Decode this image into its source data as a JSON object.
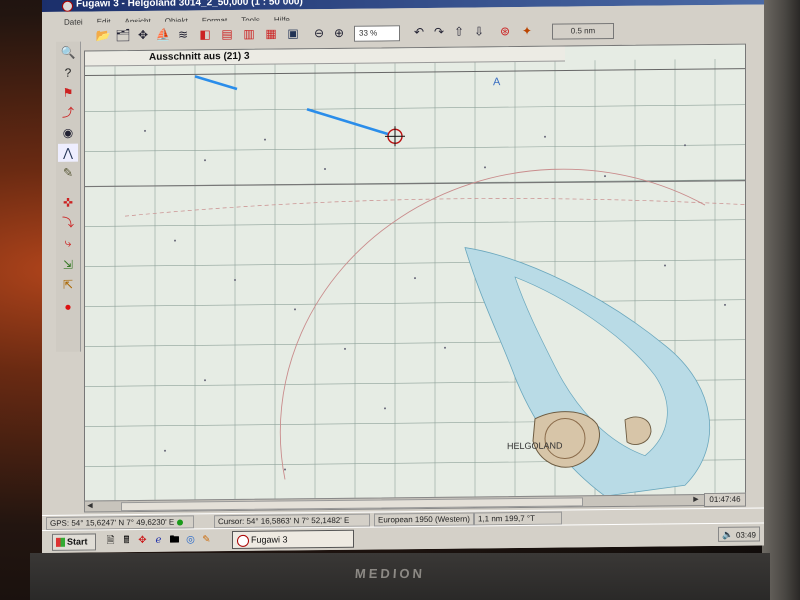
{
  "window": {
    "title": "Fugawi 3 - Helgoland 3014_2_50,000  (1 : 50 000)"
  },
  "menu": {
    "items": [
      "Datei",
      "Edit",
      "Ansicht",
      "Objekt",
      "Format",
      "Tools",
      "Hilfe"
    ]
  },
  "toolbar": {
    "zoom_value": "33 %",
    "scale_label": "0.5 nm",
    "icons": [
      "open-icon",
      "save-icon",
      "move-icon",
      "route-icon",
      "layers-icon",
      "waypoint-left-icon",
      "waypoint-list-icon",
      "route-list-icon",
      "track-icon",
      "chart-icon",
      "zoom-out-icon",
      "zoom-in-icon",
      "back-icon",
      "forward-icon",
      "up-icon",
      "down-icon",
      "gps-icon",
      "info-icon"
    ]
  },
  "left_tools": {
    "icons": [
      "zoom-tool-icon",
      "help-tool-icon",
      "waypoint-tool-icon",
      "route-tool-icon",
      "camera-icon",
      "select-icon",
      "pencil-icon",
      "crosshair-tool-icon",
      "route-edit-icon",
      "track-edit-icon",
      "chart-calibrate-icon",
      "measure-icon",
      "gps-record-icon"
    ]
  },
  "map": {
    "header_title": "Ausschnitt aus (21) 3",
    "place_label": "HELGOLAND",
    "colors": {
      "water": "#e6ece4",
      "shallows": "#b9dbe6",
      "land": "#d7c5a8",
      "grid": "#8fa29a",
      "track": "#2a8dea",
      "boundary": "#c98c8c"
    }
  },
  "scrollbar": {
    "left_arrow": "◀",
    "right_arrow": "▶"
  },
  "clock_box": "01:47:46",
  "status": {
    "gps": "GPS: 54° 15,6247' N 7° 49,6230' E",
    "cursor": "Cursor: 54° 16,5863' N 7° 52,1482' E",
    "datum": "European 1950 (Western)",
    "distance": "1,1 nm  199,7 °T"
  },
  "taskbar": {
    "start_label": "Start",
    "task_label": "Fugawi 3",
    "time": "03:49"
  },
  "bezel": {
    "brand": "MEDION"
  }
}
